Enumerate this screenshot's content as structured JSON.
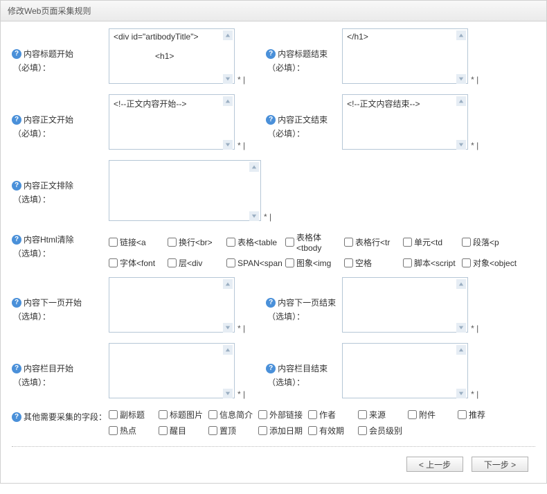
{
  "panel": {
    "title": "修改Web页面采集规则"
  },
  "fields": {
    "titleStart": {
      "label": "内容标题开始",
      "req": "（必填）：",
      "value": "<div id=\"artibodyTitle\">\n\n                  <h1>",
      "hint": "* |"
    },
    "titleEnd": {
      "label": "内容标题结束",
      "req": "（必填）：",
      "value": "</h1>",
      "hint": "* |"
    },
    "bodyStart": {
      "label": "内容正文开始",
      "req": "（必填）：",
      "value": "<!--正文内容开始-->",
      "hint": "* |"
    },
    "bodyEnd": {
      "label": "内容正文结束",
      "req": "（必填）：",
      "value": "<!--正文内容结束-->",
      "hint": "* |"
    },
    "bodyExclude": {
      "label": "内容正文排除",
      "req": "（选填）：",
      "value": "",
      "hint": "* |"
    },
    "htmlClear": {
      "label": "内容Html清除",
      "req": "（选填）："
    },
    "nextStart": {
      "label": "内容下一页开始",
      "req": "（选填）：",
      "value": "",
      "hint": "* |"
    },
    "nextEnd": {
      "label": "内容下一页结束",
      "req": "（选填）：",
      "value": "",
      "hint": "* |"
    },
    "colStart": {
      "label": "内容栏目开始",
      "req": "（选填）：",
      "value": "",
      "hint": "* |"
    },
    "colEnd": {
      "label": "内容栏目结束",
      "req": "（选填）：",
      "value": "",
      "hint": "* |"
    },
    "otherFields": {
      "label": "其他需要采集的字段："
    }
  },
  "htmlClearOptions": [
    "链接<a",
    "换行<br>",
    "表格<table",
    "表格体<tbody",
    "表格行<tr",
    "单元<td",
    "段落<p",
    "字体<font",
    "层<div",
    "SPAN<span",
    "图象<img",
    "空格",
    "脚本<script",
    "对象<object"
  ],
  "otherFieldOptions": [
    "副标题",
    "标题图片",
    "信息简介",
    "外部链接",
    "作者",
    "来源",
    "附件",
    "推荐",
    "热点",
    "醒目",
    "置顶",
    "添加日期",
    "有效期",
    "会员级别"
  ],
  "buttons": {
    "prev": "< 上一步",
    "next": "下一步 >"
  }
}
